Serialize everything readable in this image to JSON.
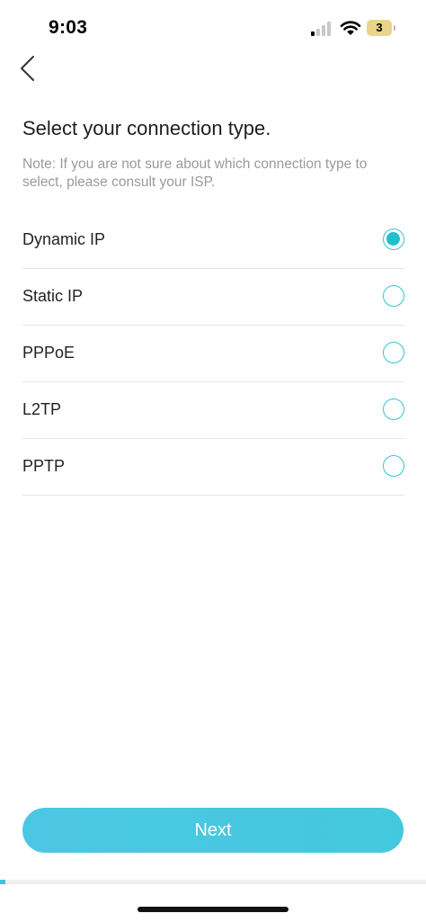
{
  "status_bar": {
    "time": "9:03",
    "battery_level": "3",
    "icons": [
      "signal-icon",
      "wifi-icon",
      "battery-icon"
    ]
  },
  "header": {
    "back_icon": "chevron-left-icon"
  },
  "content": {
    "title": "Select your connection type.",
    "note": "Note: If you are not sure about which connection type to select, please consult your ISP."
  },
  "options": [
    {
      "label": "Dynamic IP",
      "selected": true
    },
    {
      "label": "Static IP",
      "selected": false
    },
    {
      "label": "PPPoE",
      "selected": false
    },
    {
      "label": "L2TP",
      "selected": false
    },
    {
      "label": "PPTP",
      "selected": false
    }
  ],
  "footer": {
    "next_label": "Next",
    "progress": 0.012
  },
  "colors": {
    "accent": "#20bfd0",
    "button": "#4cc7e3",
    "note_text": "#9a9a9a"
  }
}
